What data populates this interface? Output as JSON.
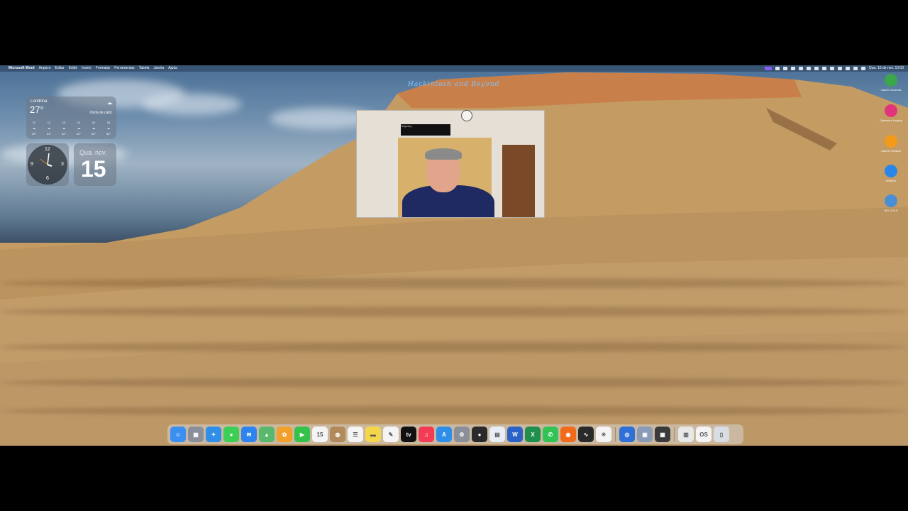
{
  "menubar": {
    "app_name": "Microsoft Word",
    "menus": [
      "Arquivo",
      "Editar",
      "Exibir",
      "Inserir",
      "Formatar",
      "Ferramentas",
      "Tabela",
      "Janela",
      "Ajuda"
    ],
    "datetime": "Qua. 15 de nov. 10:03"
  },
  "weather": {
    "city": "Londrina",
    "temp": "27°",
    "condition": "Onda de calor",
    "hours": [
      {
        "time": "11",
        "temp": "29°"
      },
      {
        "time": "12",
        "temp": "31°"
      },
      {
        "time": "13",
        "temp": "32°"
      },
      {
        "time": "14",
        "temp": "32°"
      },
      {
        "time": "15",
        "temp": "32°"
      },
      {
        "time": "16",
        "temp": "32°"
      }
    ]
  },
  "clock": {
    "n12": "12",
    "n3": "3",
    "n6": "6",
    "n9": "9"
  },
  "calendar": {
    "day": "Qua. nov.",
    "date": "15"
  },
  "watermark": "Hackintosh and Beyond",
  "webcam": {
    "tv_label": "Odyssey"
  },
  "desktop_icons": [
    {
      "label": "macOs Sonoma",
      "color": "#3aa84a"
    },
    {
      "label": "Opencore Legacy",
      "color": "#e0357a"
    },
    {
      "label": "macOs Ventura",
      "color": "#f29a1a"
    },
    {
      "label": "SN850X",
      "color": "#2a86e8"
    },
    {
      "label": "WD GOLD",
      "color": "#4a8fd6"
    }
  ],
  "dock": [
    {
      "name": "finder-icon",
      "color": "#3b8ff0",
      "glyph": "☺"
    },
    {
      "name": "launchpad-icon",
      "color": "#8a8f99",
      "glyph": "▦"
    },
    {
      "name": "safari-icon",
      "color": "#2f8ee8",
      "glyph": "✦"
    },
    {
      "name": "messages-icon",
      "color": "#3ccf55",
      "glyph": "●"
    },
    {
      "name": "mail-icon",
      "color": "#2d84f0",
      "glyph": "✉"
    },
    {
      "name": "maps-icon",
      "color": "#58b86b",
      "glyph": "▲"
    },
    {
      "name": "photos-icon",
      "color": "#f3a02a",
      "glyph": "✿"
    },
    {
      "name": "facetime-icon",
      "color": "#35c24b",
      "glyph": "▶"
    },
    {
      "name": "calendar-icon",
      "color": "#f4f4f4",
      "glyph": "15"
    },
    {
      "name": "contacts-icon",
      "color": "#b08a5a",
      "glyph": "◍"
    },
    {
      "name": "reminders-icon",
      "color": "#f4f4f4",
      "glyph": "☰"
    },
    {
      "name": "notes-icon",
      "color": "#f4d64a",
      "glyph": "▬"
    },
    {
      "name": "freeform-icon",
      "color": "#f4f4f4",
      "glyph": "✎"
    },
    {
      "name": "appletv-icon",
      "color": "#111111",
      "glyph": "tv"
    },
    {
      "name": "music-icon",
      "color": "#f43b55",
      "glyph": "♫"
    },
    {
      "name": "appstore-icon",
      "color": "#2f8ee8",
      "glyph": "A"
    },
    {
      "name": "settings-icon",
      "color": "#8a8f99",
      "glyph": "⚙"
    },
    {
      "name": "recorder-icon",
      "color": "#2a2a2a",
      "glyph": "●"
    },
    {
      "name": "preview-icon",
      "color": "#e8eef5",
      "glyph": "▤"
    },
    {
      "name": "word-icon",
      "color": "#2b62c6",
      "glyph": "W"
    },
    {
      "name": "excel-icon",
      "color": "#1f8f4d",
      "glyph": "X"
    },
    {
      "name": "whatsapp-icon",
      "color": "#31c454",
      "glyph": "✆"
    },
    {
      "name": "firefox-icon",
      "color": "#f26a1b",
      "glyph": "◉"
    },
    {
      "name": "activity-monitor-icon",
      "color": "#2a2a2a",
      "glyph": "∿"
    },
    {
      "name": "utility-icon",
      "color": "#f4f4f4",
      "glyph": "✳"
    },
    {
      "name": "network-icon",
      "color": "#2f6fd8",
      "glyph": "◎"
    },
    {
      "name": "screenshot-icon",
      "color": "#8a9cb5",
      "glyph": "▣"
    },
    {
      "name": "calculator-icon",
      "color": "#3a3a3a",
      "glyph": "▦"
    },
    {
      "name": "documents-icon",
      "color": "#e8e8e8",
      "glyph": "▥"
    },
    {
      "name": "ventura-installer-icon",
      "color": "#f4f4f4",
      "glyph": "OS"
    },
    {
      "name": "trash-icon",
      "color": "#d8dde3",
      "glyph": "▯"
    }
  ]
}
